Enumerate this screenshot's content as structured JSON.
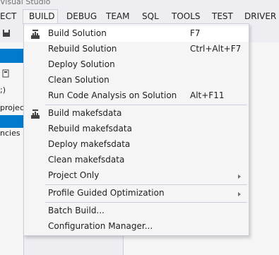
{
  "window": {
    "title": "Visual Studio"
  },
  "menubar": {
    "items": [
      "ECT",
      "BUILD",
      "DEBUG",
      "TEAM",
      "SQL",
      "TOOLS",
      "TEST",
      "DRIVER"
    ],
    "open_item": "BUILD"
  },
  "left_panel": {
    "rows": [
      ";)",
      "projec",
      "ncies"
    ]
  },
  "build_menu": {
    "items": [
      {
        "label": "Build Solution",
        "shortcut": "F7",
        "icon": "build-icon",
        "highlighted": true
      },
      {
        "label": "Rebuild Solution",
        "shortcut": "Ctrl+Alt+F7"
      },
      {
        "label": "Deploy Solution",
        "shortcut": ""
      },
      {
        "label": "Clean Solution",
        "shortcut": ""
      },
      {
        "label": "Run Code Analysis on Solution",
        "shortcut": "Alt+F11"
      },
      {
        "label": "Build makefsdata",
        "shortcut": "",
        "icon": "build-icon"
      },
      {
        "label": "Rebuild makefsdata",
        "shortcut": ""
      },
      {
        "label": "Deploy makefsdata",
        "shortcut": ""
      },
      {
        "label": "Clean makefsdata",
        "shortcut": ""
      },
      {
        "label": "Project Only",
        "shortcut": "",
        "submenu": true
      },
      {
        "label": "Profile Guided Optimization",
        "shortcut": "",
        "submenu": true
      },
      {
        "label": "Batch Build...",
        "shortcut": ""
      },
      {
        "label": "Configuration Manager...",
        "shortcut": ""
      }
    ]
  },
  "colors": {
    "accent": "#007acc",
    "menu_bg": "#f5f5f5",
    "menu_border": "#cccedb",
    "highlight": "#ffffff"
  }
}
